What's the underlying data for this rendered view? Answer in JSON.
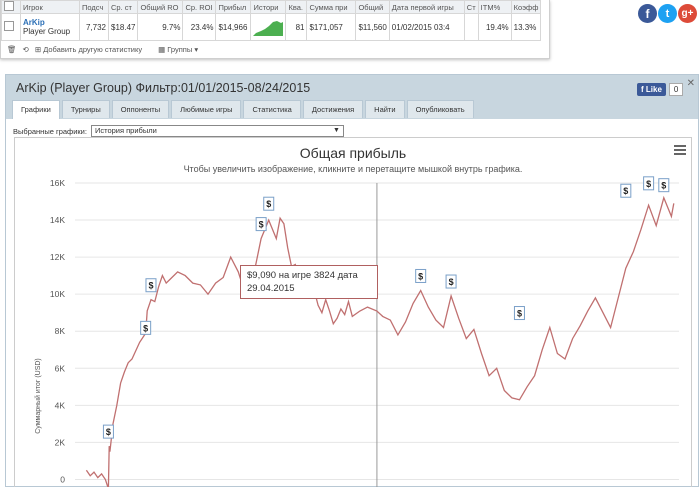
{
  "table": {
    "headers": [
      "",
      "Игрок",
      "Подсч",
      "Ср. ст",
      "Общий RO",
      "Ср. ROI",
      "Прибыл",
      "Истори",
      "Ква.",
      "Сумма при",
      "Общий",
      "Дата первой игры",
      "Ст",
      "ITM%",
      "Коэфф"
    ],
    "row": {
      "player_name": "ArKip",
      "player_group": "Player Group",
      "count": "7,732",
      "avg_stake": "$18.47",
      "total_roi": "9.7%",
      "avg_roi": "23.4%",
      "profit": "$14,966",
      "qual": "81",
      "prize_sum": "$171,057",
      "total": "$11,560",
      "first_game_date": "01/02/2015 03:4",
      "itm": "19.4%",
      "coef": "13.3%"
    }
  },
  "toolbar": {
    "add_stat_label": "Добавить другую статистику",
    "groups_label": "Группы"
  },
  "panel": {
    "title": "ArKip (Player Group) Фильтр:01/01/2015-08/24/2015",
    "fb_like_label": "Like",
    "fb_like_count": "0",
    "tabs": [
      "Графики",
      "Турниры",
      "Оппоненты",
      "Любимые игры",
      "Статистика",
      "Достижения",
      "Найти",
      "Опубликовать"
    ],
    "active_tab": "Графики",
    "selector_label": "Выбранные графики:",
    "selector_value": "История прибыли"
  },
  "colors": {
    "line": "#c07070",
    "facebook": "#3b5998",
    "twitter": "#1da1f2",
    "google": "#dd4b39",
    "header": "#c8d6df"
  },
  "icons": [
    "facebook-icon",
    "twitter-icon",
    "google-plus-icon",
    "menu-icon",
    "dollar-marker-icon",
    "trash-icon",
    "refresh-icon",
    "plus-icon",
    "close-icon"
  ],
  "chart_data": {
    "type": "line",
    "title": "Общая прибыль",
    "subtitle": "Чтобы увеличить изображение, кликните и перетащите мышкой внутрь графика.",
    "ylabel": "Суммарный итог (USD)",
    "xlabel": "",
    "ylim": [
      -1000,
      16000
    ],
    "yticks": [
      "0",
      "2K",
      "4K",
      "6K",
      "8K",
      "10K",
      "12K",
      "14K",
      "16K"
    ],
    "ytick_values": [
      0,
      2000,
      4000,
      6000,
      8000,
      10000,
      12000,
      14000,
      16000
    ],
    "x": [
      0,
      50,
      100,
      150,
      200,
      250,
      290,
      300,
      310,
      350,
      400,
      450,
      500,
      550,
      600,
      700,
      780,
      800,
      850,
      900,
      950,
      1000,
      1050,
      1100,
      1200,
      1300,
      1400,
      1500,
      1600,
      1700,
      1800,
      1900,
      2000,
      2100,
      2200,
      2300,
      2400,
      2500,
      2550,
      2600,
      2650,
      2700,
      2750,
      2800,
      2850,
      2900,
      2950,
      3000,
      3050,
      3100,
      3150,
      3200,
      3250,
      3300,
      3350,
      3400,
      3450,
      3500,
      3600,
      3700,
      3824,
      3900,
      4000,
      4100,
      4200,
      4300,
      4400,
      4500,
      4600,
      4700,
      4800,
      4900,
      5000,
      5100,
      5200,
      5300,
      5400,
      5500,
      5600,
      5700,
      5800,
      5900,
      6000,
      6100,
      6200,
      6300,
      6400,
      6500,
      6600,
      6700,
      6800,
      6900,
      7000,
      7100,
      7200,
      7300,
      7400,
      7500,
      7600,
      7700,
      7732
    ],
    "values": [
      500,
      200,
      400,
      100,
      300,
      0,
      -500,
      1800,
      1500,
      3000,
      4000,
      5200,
      5800,
      6300,
      6500,
      7400,
      7900,
      9100,
      9700,
      9600,
      10400,
      11000,
      10600,
      10800,
      11200,
      11000,
      10600,
      10500,
      10000,
      10600,
      10900,
      12000,
      11200,
      9900,
      11000,
      13000,
      14000,
      13000,
      14100,
      13800,
      12500,
      11500,
      11600,
      10500,
      11100,
      9800,
      10600,
      10200,
      9400,
      9000,
      9700,
      9100,
      8400,
      8700,
      9200,
      8900,
      9600,
      8800,
      9090,
      9300,
      9090,
      8800,
      8600,
      7800,
      8500,
      9500,
      10200,
      9300,
      8600,
      8200,
      9900,
      8700,
      7600,
      8100,
      6800,
      5600,
      6000,
      4800,
      4400,
      4300,
      5000,
      5600,
      7000,
      8200,
      6800,
      6500,
      7600,
      8300,
      9100,
      9800,
      9000,
      8200,
      9800,
      11400,
      12300,
      13500,
      14800,
      13700,
      15200,
      14200,
      14900
    ],
    "vline_x": 3824,
    "xlim": [
      -150,
      7800
    ],
    "markers": [
      {
        "x": 290,
        "y": 1800
      },
      {
        "x": 780,
        "y": 7400
      },
      {
        "x": 850,
        "y": 9700
      },
      {
        "x": 2300,
        "y": 13000
      },
      {
        "x": 2400,
        "y": 14100
      },
      {
        "x": 4400,
        "y": 10200
      },
      {
        "x": 4800,
        "y": 9900
      },
      {
        "x": 5700,
        "y": 8200
      },
      {
        "x": 7100,
        "y": 14800
      },
      {
        "x": 7400,
        "y": 15200
      },
      {
        "x": 7600,
        "y": 15100
      }
    ],
    "tooltip": {
      "line1": "$9,090 на игре 3824 дата",
      "line2": "29.04.2015"
    }
  }
}
